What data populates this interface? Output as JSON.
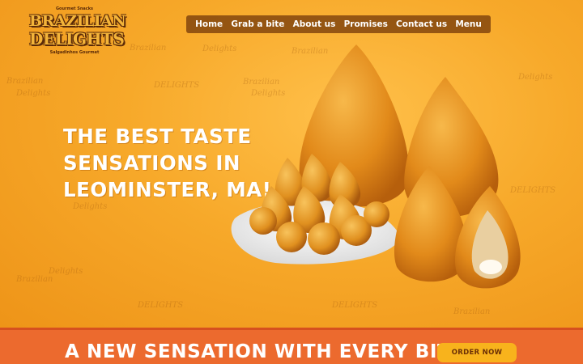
{
  "logo": {
    "top_text": "Gourmet Snacks",
    "line1": "BRAZILIAN",
    "line2": "DELIGHTS",
    "bottom_text": "Salgadinhos Gourmet"
  },
  "nav": {
    "items": [
      "Home",
      "Grab a bite",
      "About us",
      "Promises",
      "Contact us",
      "Menu"
    ]
  },
  "hero": {
    "headline_line1": "THE BEST TASTE",
    "headline_line2": "SENSATIONS IN",
    "headline_line3": "LEOMINSTER, MA!"
  },
  "pattern": {
    "words": [
      "Brazilian",
      "Delights",
      "DELIGHTS"
    ]
  },
  "footer_bar": {
    "tagline": "A NEW SENSATION WITH EVERY BITE",
    "order_button": "ORDER NOW"
  },
  "colors": {
    "hero_bg": "#f6a626",
    "nav_bg": "#783c0a",
    "bottom_bar": "#ec6a2e",
    "order_button": "#f8b31c"
  }
}
